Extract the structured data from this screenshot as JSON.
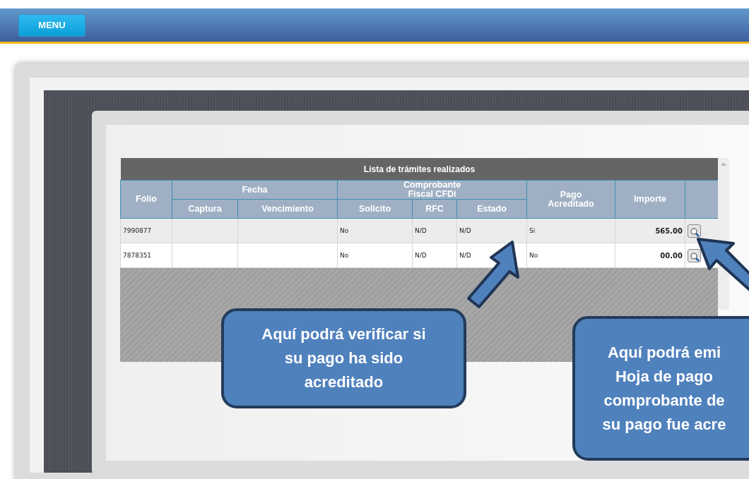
{
  "header": {
    "menu_button": "MENU"
  },
  "table": {
    "title": "Lista de trámites realizados",
    "groups": [
      {
        "label": "Fólio"
      },
      {
        "label": "Fecha",
        "subcolumns": [
          "Captura",
          "Vencimiento"
        ]
      },
      {
        "label": "Comprobante Fiscal CFDi",
        "subcolumns": [
          "Solicito",
          "RFC",
          "Estado"
        ]
      },
      {
        "label": "Pago Acreditado"
      },
      {
        "label": "Importe"
      }
    ],
    "rows": [
      {
        "folio": "7990877",
        "solicito": "No",
        "rfc": "N/D",
        "estado": "N/D",
        "pago": "Si",
        "importe": "565.00"
      },
      {
        "folio": "7878351",
        "solicito": "No",
        "rfc": "N/D",
        "estado": "N/D",
        "pago": "No",
        "importe": "00.00"
      }
    ]
  },
  "callouts": [
    {
      "lines": [
        "Aquí podrá verificar si",
        "su pago ha sido",
        "acreditado"
      ]
    },
    {
      "lines": [
        "Aquí podrá emi",
        "Hoja de pago",
        "comprobante de",
        "su pago fue acre"
      ]
    }
  ]
}
